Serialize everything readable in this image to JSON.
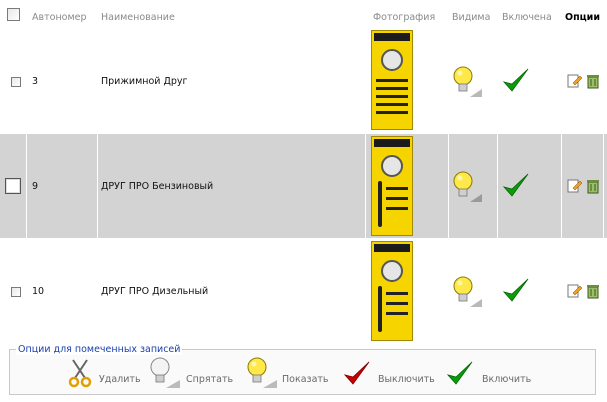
{
  "header": {
    "autonumber": "Автономер",
    "name": "Наименование",
    "photo": "Фотография",
    "visible": "Видима",
    "enabled": "Включена",
    "options": "Опции"
  },
  "rows": [
    {
      "id": "3",
      "name": "Прижимной Друг"
    },
    {
      "id": "9",
      "name": "ДРУГ ПРО Бензиновый"
    },
    {
      "id": "10",
      "name": "ДРУГ ПРО Дизельный"
    }
  ],
  "bulk": {
    "legend": "Опции для помеченных записей",
    "delete": "Удалить",
    "hide": "Спрятать",
    "show": "Показать",
    "disable": "Выключить",
    "enable": "Включить"
  },
  "colors": {
    "shade": "#d3d3d3",
    "legend": "#1a3fb0",
    "check": "#0a9d0a",
    "uncheck": "#cc0000",
    "bulb": "#ffe84a"
  }
}
